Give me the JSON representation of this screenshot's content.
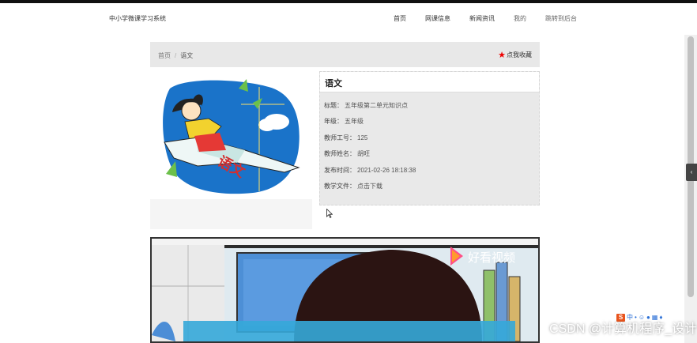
{
  "navbar": {
    "brand": "中小学微课学习系统",
    "items": [
      {
        "label": "首页"
      },
      {
        "label": "网课信息"
      },
      {
        "label": "新闻资讯"
      },
      {
        "label": "我的"
      },
      {
        "label": "跳转到后台"
      }
    ]
  },
  "breadcrumb": {
    "home": "首页",
    "separator": "/",
    "current": "语文"
  },
  "favorite": {
    "label": "点我收藏",
    "icon": "star-icon",
    "color": "#e00000"
  },
  "cover": {
    "glyphs": "语文"
  },
  "detail": {
    "title": "语文",
    "rows": [
      {
        "key": "标题：",
        "value": "五年级第二单元知识点"
      },
      {
        "key": "年级：",
        "value": "五年级"
      },
      {
        "key": "教师工号：",
        "value": "125"
      },
      {
        "key": "教师姓名：",
        "value": "胡旺"
      },
      {
        "key": "发布时间：",
        "value": "2021-02-26 18:18:38"
      },
      {
        "key": "教学文件：",
        "value": "点击下载"
      }
    ]
  },
  "video": {
    "logo_text": "好看视频"
  },
  "sidetab": {
    "glyph": "‹"
  },
  "tray": {
    "badge": "S",
    "label": "中"
  },
  "watermark": "CSDN @计算机程序_设计"
}
